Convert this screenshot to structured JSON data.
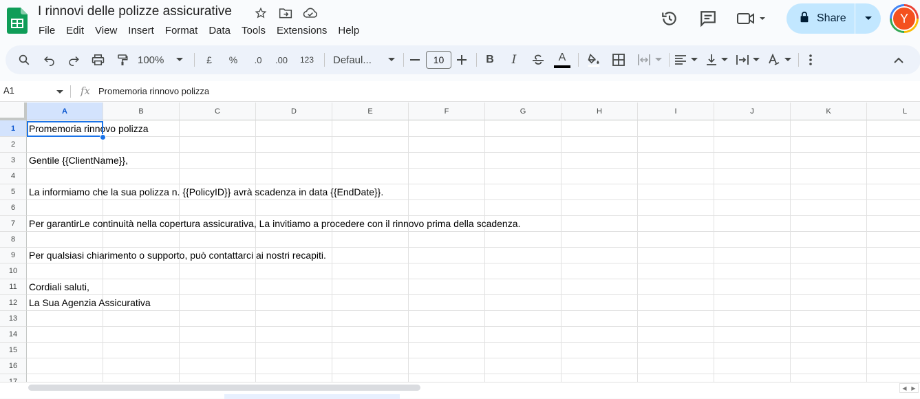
{
  "app": {
    "doc_title": "I rinnovi delle polizze assicurative",
    "menu": [
      "File",
      "Edit",
      "View",
      "Insert",
      "Format",
      "Data",
      "Tools",
      "Extensions",
      "Help"
    ],
    "share_label": "Share",
    "avatar_letter": "Y"
  },
  "toolbar": {
    "zoom": "100%",
    "currency": "£",
    "percent": "%",
    "dec_decrease": ".0",
    "dec_increase": ".00",
    "number_format": "123",
    "font": "Defaul...",
    "font_size": "10",
    "bold": "B",
    "italic": "I",
    "text_color_letter": "A"
  },
  "formula_bar": {
    "cell_ref": "A1",
    "fx": "fx",
    "value": "Promemoria rinnovo polizza"
  },
  "columns": [
    "A",
    "B",
    "C",
    "D",
    "E",
    "F",
    "G",
    "H",
    "I",
    "J",
    "K",
    "L"
  ],
  "rows": [
    "1",
    "2",
    "3",
    "4",
    "5",
    "6",
    "7",
    "8",
    "9",
    "10",
    "11",
    "12",
    "13",
    "14",
    "15",
    "16",
    "17"
  ],
  "cells": {
    "r1": "Promemoria rinnovo polizza",
    "r3": "Gentile {{ClientName}},",
    "r5": "La informiamo che la sua polizza n. {{PolicyID}} avrà scadenza in data {{EndDate}}.",
    "r7": "Per garantirLe continuità nella copertura assicurativa, La invitiamo a procedere con il rinnovo prima della scadenza.",
    "r9": "Per qualsiasi chiarimento o supporto, può contattarci ai nostri recapiti.",
    "r11": "Cordiali saluti,",
    "r12": "La Sua Agenzia Assicurativa"
  },
  "colors": {
    "accent": "#1a73e8",
    "share_bg": "#c2e7ff",
    "sheets_green": "#0f9d58",
    "avatar_bg": "#f4511e"
  }
}
